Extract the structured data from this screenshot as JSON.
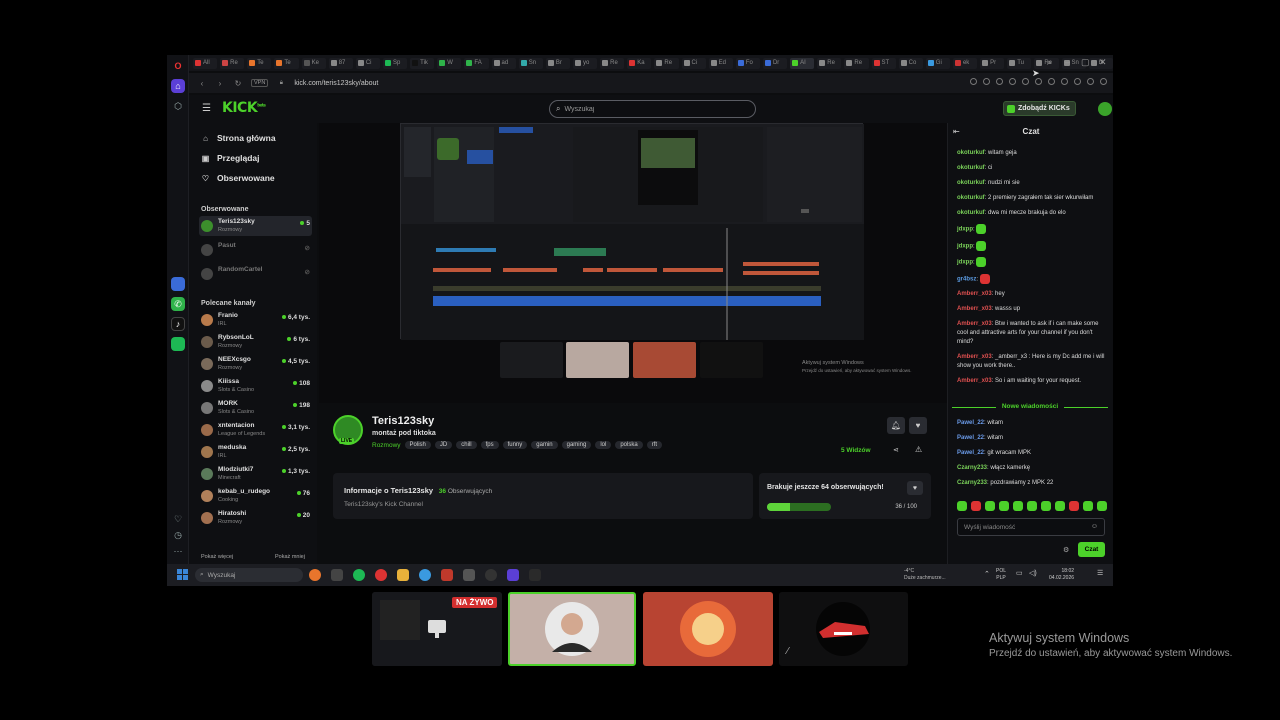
{
  "browser": {
    "url": "kick.com/teris123sky/about",
    "vpn": "VPN",
    "tabs": [
      "All",
      "Re",
      "Te",
      "Te",
      "Ke",
      "87",
      "Ci",
      "Sp",
      "Tik",
      "W",
      "FA",
      "ad",
      "Sn",
      "Br",
      "yo",
      "Re",
      "Ka",
      "Re",
      "Ci",
      "Ed",
      "Fo",
      "Dr",
      "AI",
      "Re",
      "Re",
      "ST",
      "Co",
      "Gi",
      "ek",
      "Pr",
      "Tu",
      "Re",
      "Sn",
      "bl"
    ]
  },
  "header": {
    "logo": "KICK",
    "logo_sup": "beta",
    "search_placeholder": "Wyszukaj",
    "get_kicks": "Zdobądź KICKs"
  },
  "sidebar": {
    "nav": [
      {
        "label": "Strona główna",
        "icon": "home-icon"
      },
      {
        "label": "Przeglądaj",
        "icon": "browse-icon"
      },
      {
        "label": "Obserwowane",
        "icon": "heart-icon"
      }
    ],
    "following_title": "Obserwowane",
    "following": [
      {
        "name": "Teris123sky",
        "category": "Rozmowy",
        "viewers": "5",
        "live": true,
        "color": "#3c8f2c"
      },
      {
        "name": "Pasut",
        "category": "",
        "viewers": "",
        "live": false,
        "color": "#444"
      },
      {
        "name": "RandomCartel",
        "category": "",
        "viewers": "",
        "live": false,
        "color": "#444"
      }
    ],
    "recommended_title": "Polecane kanały",
    "recommended": [
      {
        "name": "Franio",
        "category": "IRL",
        "viewers": "6,4 tys.",
        "color": "#b87a4b"
      },
      {
        "name": "RybsonLoL",
        "category": "Rozmowy",
        "viewers": "6 tys.",
        "color": "#6b5b4b"
      },
      {
        "name": "NEEXcsgo",
        "category": "Rozmowy",
        "viewers": "4,5 tys.",
        "color": "#7a6a5a"
      },
      {
        "name": "Kiiissa",
        "category": "Slots & Casino",
        "viewers": "108",
        "color": "#8a8a8a"
      },
      {
        "name": "MORK",
        "category": "Slots & Casino",
        "viewers": "198",
        "color": "#777"
      },
      {
        "name": "xntentacion",
        "category": "League of Legends",
        "viewers": "3,1 tys.",
        "color": "#9a6a4a"
      },
      {
        "name": "meduska",
        "category": "IRL",
        "viewers": "2,5 tys.",
        "color": "#a0764e"
      },
      {
        "name": "Mlodziutki7",
        "category": "Minecraft",
        "viewers": "1,3 tys.",
        "color": "#5a7a5a"
      },
      {
        "name": "kebab_u_rudego",
        "category": "Cooking",
        "viewers": "76",
        "color": "#b0805a"
      },
      {
        "name": "Hiratoshi",
        "category": "Rozmowy",
        "viewers": "20",
        "color": "#a27050"
      }
    ],
    "show_more": "Pokaż więcej",
    "show_less": "Pokaż mniej"
  },
  "video": {
    "activate_title": "Aktywuj system Windows",
    "activate_sub": "Przejdź do ustawień, aby aktywować system Windows."
  },
  "stream": {
    "name": "Teris123sky",
    "title": "montaż pod tiktoka",
    "live_badge": "LIVE",
    "category": "Rozmowy",
    "tags": [
      "Polish",
      "JD",
      "chill",
      "fps",
      "funny",
      "gamin",
      "gaming",
      "lol",
      "polska",
      "rft"
    ],
    "viewers": "5 Widzów"
  },
  "about": {
    "title": "Informacje o Teris123sky",
    "followers_count": "36",
    "followers_label": "Obserwujących",
    "description": "Teris123sky's Kick Channel"
  },
  "goal": {
    "title": "Brakuje jeszcze 64 obserwujących!",
    "current": 36,
    "target": 100,
    "progress_text": "36 / 100",
    "fraction": 0.36
  },
  "chat": {
    "title": "Czat",
    "messages": [
      {
        "user": "okoturkuf",
        "color": "#7bd35a",
        "text": "witam geja"
      },
      {
        "user": "okoturkuf",
        "color": "#7bd35a",
        "text": "ci"
      },
      {
        "user": "okoturkuf",
        "color": "#7bd35a",
        "text": "nudzi mi sie"
      },
      {
        "user": "okoturkuf",
        "color": "#7bd35a",
        "text": "2 premiery zagrałem tak sier wkurwiłam"
      },
      {
        "user": "okoturkuf",
        "color": "#7bd35a",
        "text": "dwa mi mecze brakuja do elo"
      },
      {
        "user": "jdxpp",
        "color": "#7bd35a",
        "text": ""
      },
      {
        "user": "jdxpp",
        "color": "#7bd35a",
        "text": ""
      },
      {
        "user": "jdxpp",
        "color": "#7bd35a",
        "text": ""
      },
      {
        "user": "gr4bsz",
        "color": "#5a9ae0",
        "text": ""
      },
      {
        "user": "Amberr_x03",
        "color": "#e05050",
        "text": "hey"
      },
      {
        "user": "Amberr_x03",
        "color": "#e05050",
        "text": "wasss up"
      },
      {
        "user": "Amberr_x03",
        "color": "#e05050",
        "text": "Btw i wanted to ask if i can make some cool and attractive arts for your channel if you don't mind?"
      },
      {
        "user": "Amberr_x03",
        "color": "#e05050",
        "text": "_amberr_x3 : Here is my Dc add me i will show you work there.."
      },
      {
        "user": "Amberr_x03",
        "color": "#e05050",
        "text": "So i am waiting for your request."
      }
    ],
    "new_messages_label": "Nowe wiadomości",
    "new_messages": [
      {
        "user": "Pawel_22",
        "color": "#6a9ae8",
        "text": "witam"
      },
      {
        "user": "Pawel_22",
        "color": "#6a9ae8",
        "text": "witam"
      },
      {
        "user": "Pawel_22",
        "color": "#6a9ae8",
        "text": "git wracam MPK"
      },
      {
        "user": "Czarny233",
        "color": "#7bd35a",
        "text": "włącz kamerkę"
      },
      {
        "user": "Czarny233",
        "color": "#7bd35a",
        "text": "pozdrawiamy z MPK 22"
      }
    ],
    "input_placeholder": "Wyślij wiadomość",
    "send_label": "Czat"
  },
  "taskbar": {
    "search": "Wyszukaj",
    "weather_temp": "-4°C",
    "weather_desc": "Duże zachmurze...",
    "lang1": "POL",
    "lang2": "PLP",
    "time": "18:02",
    "date": "04.02.2026"
  },
  "overlay": {
    "live_label": "NA ŻYWO",
    "activate_title": "Aktywuj system Windows",
    "activate_sub": "Przejdź do ustawień, aby aktywować system Windows."
  }
}
